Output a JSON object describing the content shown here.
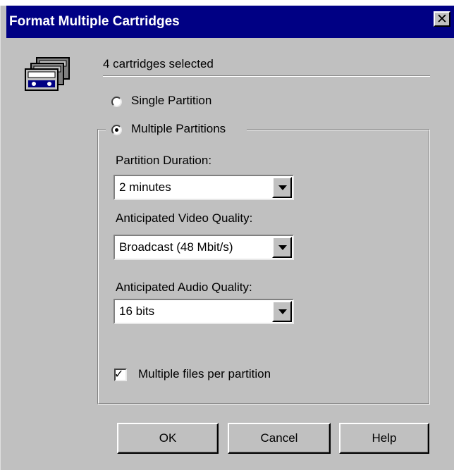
{
  "window": {
    "title": "Format Multiple Cartridges",
    "close_glyph": "✕",
    "close_icon": "close-icon"
  },
  "header": {
    "icon": "cartridges-icon",
    "selection_text": "4 cartridges selected"
  },
  "partition_mode": {
    "single_label": "Single Partition",
    "multiple_label": "Multiple Partitions",
    "selected": "multiple"
  },
  "fields": {
    "duration": {
      "label": "Partition Duration:",
      "value": "2 minutes"
    },
    "video": {
      "label": "Anticipated Video Quality:",
      "value": "Broadcast (48 Mbit/s)"
    },
    "audio": {
      "label": "Anticipated Audio Quality:",
      "value": "16 bits"
    }
  },
  "options": {
    "multiple_files_label": "Multiple files per partition",
    "multiple_files_checked": true,
    "check_glyph": "✓"
  },
  "buttons": {
    "ok": "OK",
    "cancel": "Cancel",
    "help": "Help"
  },
  "colors": {
    "titlebar": "#000084",
    "dialog_bg": "#c0c0c0"
  }
}
